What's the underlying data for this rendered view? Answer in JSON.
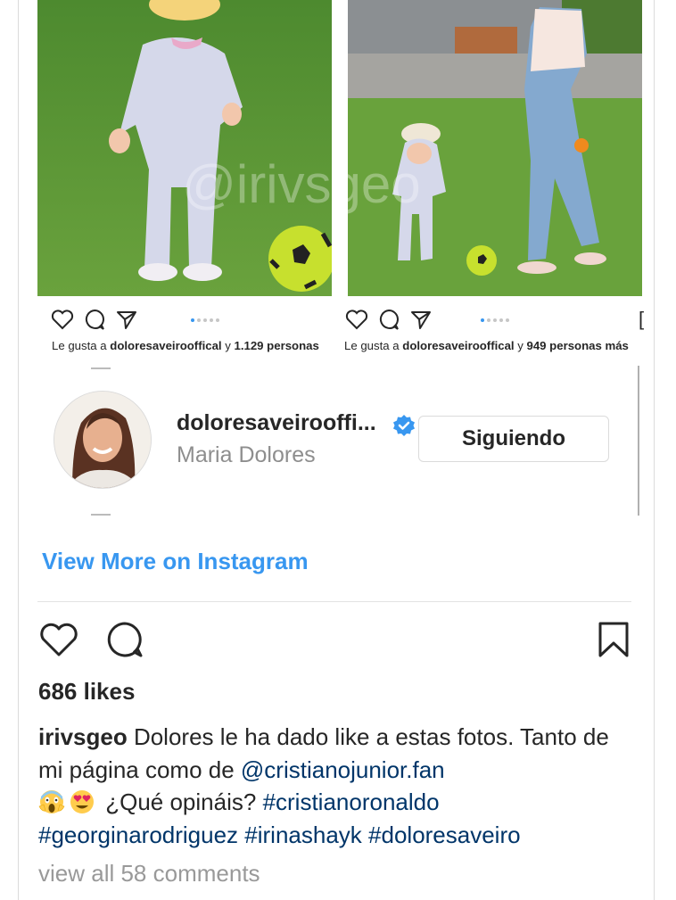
{
  "watermark": "@irivsgeo",
  "collage": {
    "left_likes": {
      "prefix": "Le gusta a ",
      "user": "doloresaveirooffical",
      "middle": " y ",
      "count": "1.129 personas"
    },
    "right_likes": {
      "prefix": "Le gusta a ",
      "user": "doloresaveirooffical",
      "middle": " y ",
      "count": "949 personas más"
    },
    "carousel_dots": 5,
    "active_dot": 1
  },
  "suggestion": {
    "username": "doloresaveiroofficial",
    "username_display": "doloresaveirooffi...",
    "full_name": "Maria Dolores",
    "follow_label": "Siguiendo"
  },
  "view_more_label": "View More on Instagram",
  "post": {
    "likes": "686 likes",
    "author": "irivsgeo",
    "caption_part1": " Dolores le ha dado like a estas fotos. Tanto de mi página como de ",
    "mention": "@cristianojunior.fan",
    "caption_part2": " ¿Qué opináis? ",
    "hashtags": [
      "#cristianoronaldo",
      "#georginarodriguez",
      "#irinashayk",
      "#doloresaveiro"
    ],
    "emojis": [
      "scream-emoji",
      "heart-eyes-emoji"
    ],
    "comments_label": "view all 58 comments"
  },
  "colors": {
    "link_blue": "#3897f0",
    "hashtag_blue": "#003569",
    "muted": "#8e8e8e",
    "text": "#262626"
  }
}
